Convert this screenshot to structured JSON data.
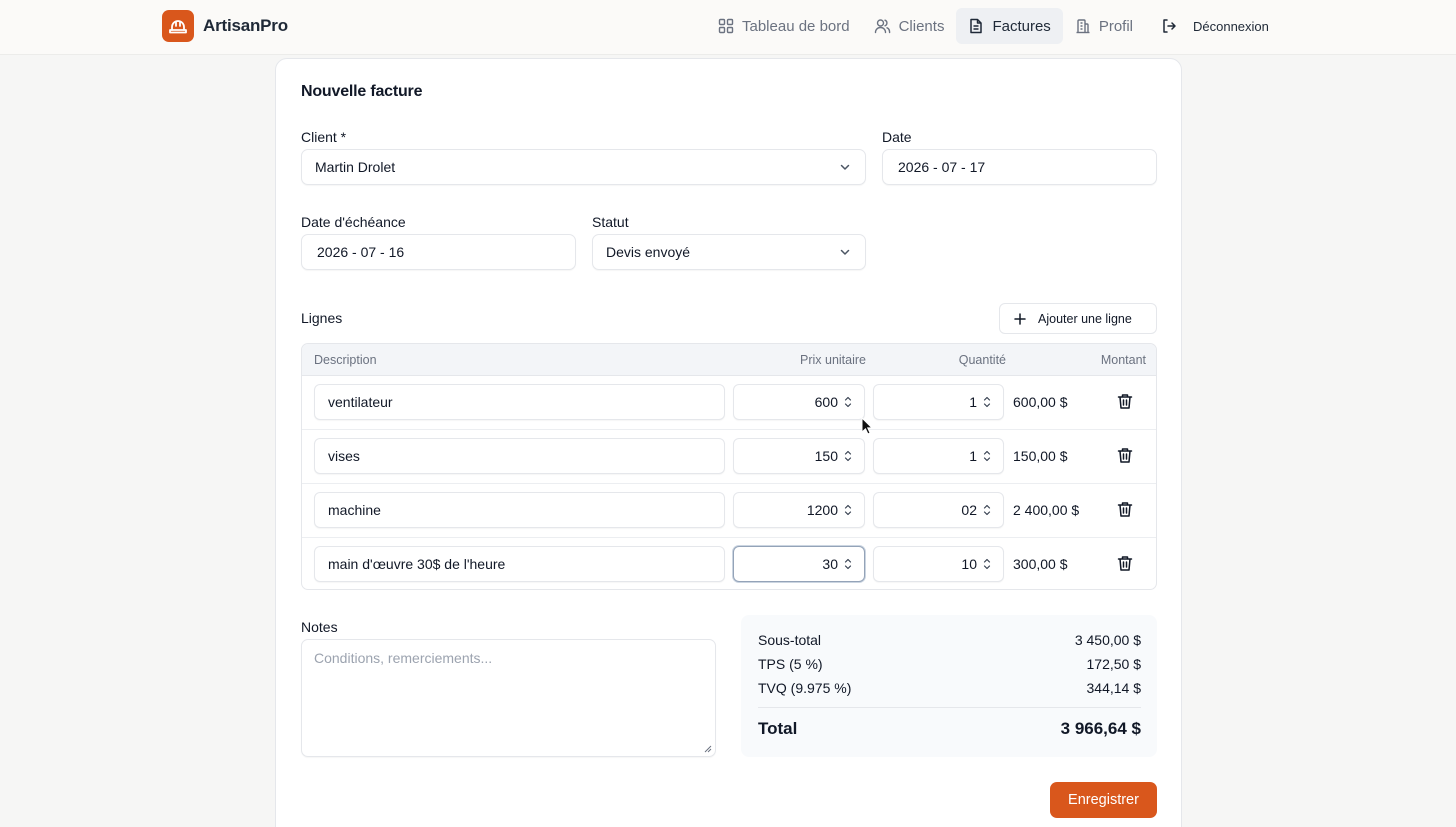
{
  "brand": {
    "name": "ArtisanPro"
  },
  "nav": {
    "items": [
      {
        "label": "Tableau de bord",
        "icon": "dashboard-icon"
      },
      {
        "label": "Clients",
        "icon": "users-icon"
      },
      {
        "label": "Factures",
        "icon": "file-icon",
        "active": true
      },
      {
        "label": "Profil",
        "icon": "building-icon"
      }
    ],
    "logout": "Déconnexion"
  },
  "form": {
    "title": "Nouvelle facture",
    "client": {
      "label": "Client *",
      "value": "Martin Drolet"
    },
    "date": {
      "label": "Date",
      "value": "2026 - 07 - 17"
    },
    "due_date": {
      "label": "Date d'échéance",
      "value": "2026 - 07 - 16"
    },
    "status": {
      "label": "Statut",
      "value": "Devis envoyé"
    }
  },
  "lines": {
    "label": "Lignes",
    "add_label": "Ajouter une ligne",
    "headers": {
      "description": "Description",
      "unit_price": "Prix unitaire",
      "quantity": "Quantité",
      "amount": "Montant"
    },
    "rows": [
      {
        "description": "ventilateur",
        "price": "600",
        "qty": "1",
        "amount": "600,00 $"
      },
      {
        "description": "vises",
        "price": "150",
        "qty": "1",
        "amount": "150,00 $"
      },
      {
        "description": "machine",
        "price": "1200",
        "qty": "02",
        "amount": "2 400,00 $"
      },
      {
        "description": "main d'œuvre 30$ de l'heure",
        "price": "30",
        "qty": "10",
        "amount": "300,00 $"
      }
    ]
  },
  "notes": {
    "label": "Notes",
    "placeholder": "Conditions, remerciements..."
  },
  "totals": {
    "subtotal_label": "Sous-total",
    "subtotal": "3 450,00 $",
    "tps_label": "TPS (5 %)",
    "tps": "172,50 $",
    "tvq_label": "TVQ (9.975 %)",
    "tvq": "344,14 $",
    "total_label": "Total",
    "total": "3 966,64 $"
  },
  "save_label": "Enregistrer",
  "colors": {
    "accent": "#d9571c"
  }
}
